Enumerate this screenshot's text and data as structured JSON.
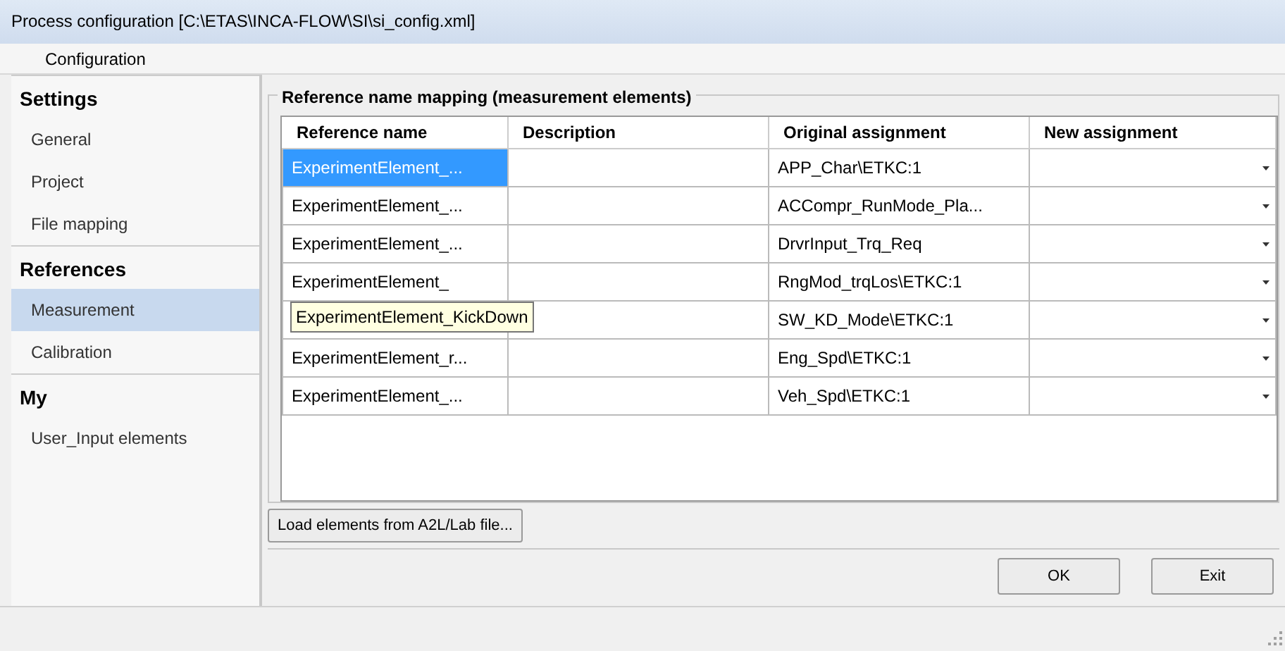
{
  "window": {
    "title": "Process configuration [C:\\ETAS\\INCA-FLOW\\SI\\si_config.xml]"
  },
  "menu": [
    "Configuration"
  ],
  "sidebar": {
    "groups": [
      {
        "title": "Settings",
        "items": [
          {
            "label": "General",
            "selected": false
          },
          {
            "label": "Project",
            "selected": false
          },
          {
            "label": "File mapping",
            "selected": false
          }
        ]
      },
      {
        "title": "References",
        "items": [
          {
            "label": "Measurement",
            "selected": true
          },
          {
            "label": "Calibration",
            "selected": false
          }
        ]
      },
      {
        "title": "My",
        "items": [
          {
            "label": "User_Input elements",
            "selected": false
          }
        ]
      }
    ]
  },
  "group": {
    "title": "Reference name mapping (measurement elements)"
  },
  "table": {
    "columns": [
      "Reference name",
      "Description",
      "Original assignment",
      "New assignment"
    ],
    "rows": [
      {
        "reference_name": "ExperimentElement_...",
        "original_assignment": "APP_Char\\ETKC:1",
        "selected": true
      },
      {
        "reference_name": "ExperimentElement_...",
        "original_assignment": "ACCompr_RunMode_Pla...",
        "selected": false
      },
      {
        "reference_name": "ExperimentElement_...",
        "original_assignment": "DrvrInput_Trq_Req",
        "selected": false
      },
      {
        "reference_name": "ExperimentElement_",
        "original_assignment": "RngMod_trqLos\\ETKC:1",
        "selected": false
      },
      {
        "reference_name": "",
        "original_assignment": "SW_KD_Mode\\ETKC:1",
        "selected": false
      },
      {
        "reference_name": "ExperimentElement_r...",
        "original_assignment": "Eng_Spd\\ETKC:1",
        "selected": false
      },
      {
        "reference_name": "ExperimentElement_...",
        "original_assignment": "Veh_Spd\\ETKC:1",
        "selected": false
      }
    ]
  },
  "tooltip": {
    "text": "ExperimentElement_KickDown"
  },
  "load_button": "Load elements from A2L/Lab file...",
  "buttons": [
    "OK",
    "Exit"
  ]
}
